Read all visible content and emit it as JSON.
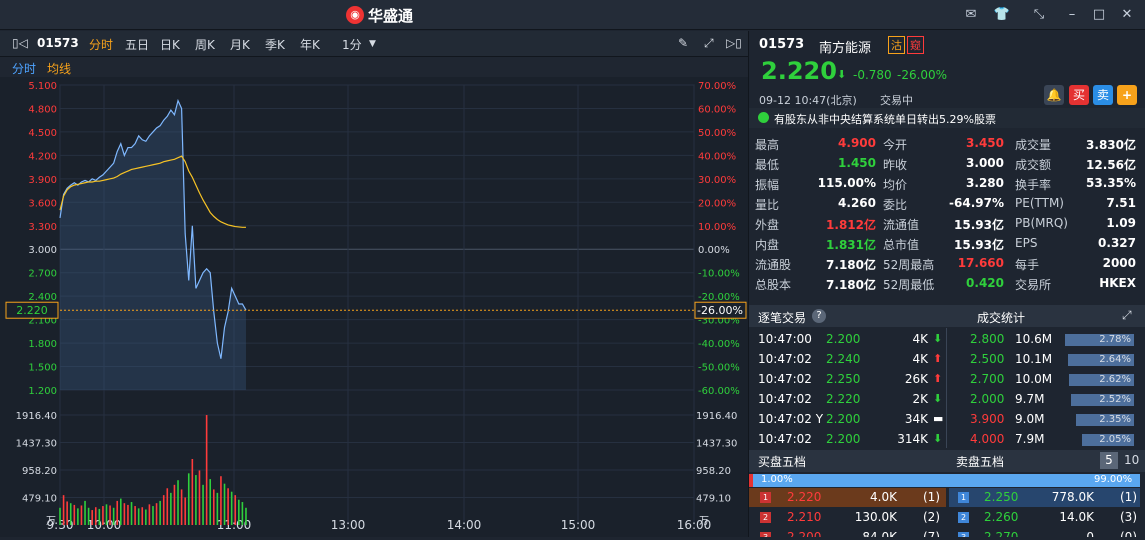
{
  "app": {
    "title": "华盛通"
  },
  "toolbar": {
    "code": "01573",
    "tabs": [
      "分时",
      "五日",
      "日K",
      "周K",
      "月K",
      "季K",
      "年K"
    ],
    "interval": "1分"
  },
  "subbar": {
    "tabs": [
      "分时",
      "均线"
    ]
  },
  "quote": {
    "code": "01573",
    "name": "南方能源",
    "badge1": "沽",
    "badge2": "窥",
    "price": "2.220",
    "change": "-0.780",
    "pct": "-26.00%",
    "time": "09-12  10:47(北京)",
    "status": "交易中",
    "notice": "有股东从非中央结算系统单日转出5.29%股票",
    "buttons": {
      "buy": "买",
      "sell": "卖",
      "add": "+"
    }
  },
  "stats": [
    [
      [
        "最高",
        "4.900",
        "red"
      ],
      [
        "今开",
        "3.450",
        "red"
      ],
      [
        "成交量",
        "3.830亿",
        "white"
      ]
    ],
    [
      [
        "最低",
        "1.450",
        "green"
      ],
      [
        "昨收",
        "3.000",
        "white"
      ],
      [
        "成交额",
        "12.56亿",
        "white"
      ]
    ],
    [
      [
        "振幅",
        "115.00%",
        "white"
      ],
      [
        "均价",
        "3.280",
        "white"
      ],
      [
        "换手率",
        "53.35%",
        "white"
      ]
    ],
    [
      [
        "量比",
        "4.260",
        "white"
      ],
      [
        "委比",
        "-64.97%",
        "white"
      ],
      [
        "PE(TTM)",
        "7.51",
        "white"
      ]
    ],
    [
      [
        "外盘",
        "1.812亿",
        "red"
      ],
      [
        "流通值",
        "15.93亿",
        "white"
      ],
      [
        "PB(MRQ)",
        "1.09",
        "white"
      ]
    ],
    [
      [
        "内盘",
        "1.831亿",
        "green"
      ],
      [
        "总市值",
        "15.93亿",
        "white"
      ],
      [
        "EPS",
        "0.327",
        "white"
      ]
    ],
    [
      [
        "流通股",
        "7.180亿",
        "white"
      ],
      [
        "52周最高",
        "17.660",
        "red"
      ],
      [
        "每手",
        "2000",
        "white"
      ]
    ],
    [
      [
        "总股本",
        "7.180亿",
        "white"
      ],
      [
        "52周最低",
        "0.420",
        "green"
      ],
      [
        "交易所",
        "HKEX",
        "white"
      ]
    ]
  ],
  "trades": {
    "title": "逐笔交易",
    "stats_title": "成交统计",
    "rows": [
      {
        "time": "10:47:00",
        "price": "2.200",
        "vol": "4K",
        "dir": "down"
      },
      {
        "time": "10:47:02",
        "price": "2.240",
        "vol": "4K",
        "dir": "up"
      },
      {
        "time": "10:47:02",
        "price": "2.250",
        "vol": "26K",
        "dir": "up"
      },
      {
        "time": "10:47:02",
        "price": "2.220",
        "vol": "2K",
        "dir": "down"
      },
      {
        "time": "10:47:02 Y",
        "price": "2.200",
        "vol": "34K",
        "dir": "flat"
      },
      {
        "time": "10:47:02",
        "price": "2.200",
        "vol": "314K",
        "dir": "down"
      }
    ],
    "stat_rows": [
      {
        "price": "2.800",
        "vol": "10.6M",
        "pct": "2.78%",
        "frac": 0.62,
        "color": "green"
      },
      {
        "price": "2.500",
        "vol": "10.1M",
        "pct": "2.64%",
        "frac": 0.59,
        "color": "green"
      },
      {
        "price": "2.700",
        "vol": "10.0M",
        "pct": "2.62%",
        "frac": 0.58,
        "color": "green"
      },
      {
        "price": "2.000",
        "vol": "9.7M",
        "pct": "2.52%",
        "frac": 0.56,
        "color": "green"
      },
      {
        "price": "3.900",
        "vol": "9.0M",
        "pct": "2.35%",
        "frac": 0.52,
        "color": "red"
      },
      {
        "price": "4.000",
        "vol": "7.9M",
        "pct": "2.05%",
        "frac": 0.46,
        "color": "red"
      }
    ]
  },
  "book": {
    "buy_title": "买盘五档",
    "sell_title": "卖盘五档",
    "levels": [
      "5",
      "10"
    ],
    "buy_pct": "1.00%",
    "sell_pct": "99.00%",
    "buy_frac": 0.01,
    "bids": [
      {
        "n": "1",
        "price": "2.220",
        "vol": "4.0K",
        "cnt": "(1)"
      },
      {
        "n": "2",
        "price": "2.210",
        "vol": "130.0K",
        "cnt": "(2)"
      },
      {
        "n": "3",
        "price": "2.200",
        "vol": "84.0K",
        "cnt": "(7)"
      }
    ],
    "asks": [
      {
        "n": "1",
        "price": "2.250",
        "vol": "778.0K",
        "cnt": "(1)"
      },
      {
        "n": "2",
        "price": "2.260",
        "vol": "14.0K",
        "cnt": "(3)"
      },
      {
        "n": "3",
        "price": "2.270",
        "vol": "0",
        "cnt": "(0)"
      }
    ]
  },
  "chart_data": {
    "type": "line",
    "price_ticks": [
      "5.100",
      "4.800",
      "4.500",
      "4.200",
      "3.900",
      "3.600",
      "3.300",
      "3.000",
      "2.700",
      "2.400",
      "2.100",
      "1.800",
      "1.500",
      "1.200"
    ],
    "pct_ticks": [
      "70.00%",
      "60.00%",
      "50.00%",
      "40.00%",
      "30.00%",
      "20.00%",
      "10.00%",
      "0.00%",
      "-10.00%",
      "-20.00%",
      "-30.00%",
      "-40.00%",
      "-50.00%",
      "-60.00%"
    ],
    "prev_close": 3.0,
    "ylim": [
      1.2,
      5.1
    ],
    "current_price": "2.220",
    "current_pct": "-26.00%",
    "vol_ticks": [
      "1916.40",
      "1437.30",
      "958.20",
      "479.10",
      "万"
    ],
    "x_ticks": [
      "9:30",
      "10:00",
      "11:00",
      "13:00",
      "14:00",
      "15:00",
      "16:00"
    ],
    "price_series": [
      3.4,
      3.7,
      3.78,
      3.82,
      3.85,
      3.82,
      3.86,
      3.88,
      3.86,
      3.9,
      3.88,
      3.92,
      3.95,
      4.0,
      4.05,
      4.1,
      4.25,
      4.35,
      4.2,
      4.3,
      4.3,
      4.35,
      4.45,
      4.4,
      4.38,
      4.45,
      4.5,
      4.55,
      4.58,
      4.65,
      4.7,
      4.78,
      4.72,
      4.9,
      4.8,
      3.2,
      2.6,
      3.3,
      2.5,
      2.6,
      2.7,
      2.75,
      2.7,
      2.2,
      1.8,
      1.6,
      2.0,
      2.2,
      2.5,
      2.4,
      2.3,
      2.3,
      2.22
    ],
    "avg_series": [
      3.5,
      3.68,
      3.76,
      3.8,
      3.82,
      3.83,
      3.84,
      3.85,
      3.86,
      3.86,
      3.87,
      3.87,
      3.88,
      3.89,
      3.9,
      3.91,
      3.93,
      3.96,
      3.98,
      4.0,
      4.02,
      4.03,
      4.04,
      4.05,
      4.06,
      4.07,
      4.08,
      4.09,
      4.1,
      4.12,
      4.13,
      4.14,
      4.15,
      4.17,
      4.19,
      4.12,
      4.0,
      3.92,
      3.82,
      3.72,
      3.63,
      3.55,
      3.47,
      3.42,
      3.38,
      3.35,
      3.33,
      3.31,
      3.3,
      3.29,
      3.285,
      3.28,
      3.28
    ],
    "vol_series": [
      300,
      520,
      410,
      380,
      350,
      290,
      340,
      420,
      300,
      260,
      310,
      280,
      330,
      360,
      340,
      300,
      420,
      460,
      380,
      350,
      400,
      330,
      290,
      310,
      270,
      360,
      330,
      380,
      420,
      520,
      640,
      560,
      700,
      780,
      620,
      480,
      900,
      1150,
      870,
      950,
      700,
      1916,
      800,
      620,
      560,
      850,
      720,
      640,
      580,
      520,
      440,
      400,
      300
    ],
    "vol_colors": "grrgrgrggrrgrgrgrgrrgrgrgrgrgrrgrgrrgrgrgrgrgrgrgrg"
  }
}
